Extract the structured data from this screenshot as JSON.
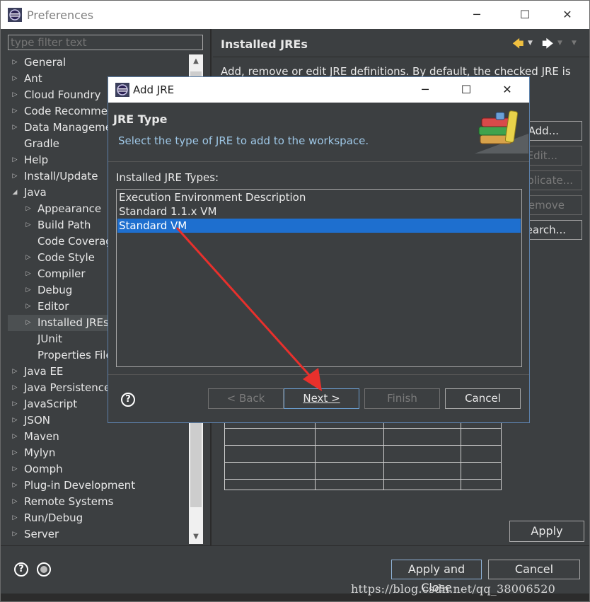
{
  "window": {
    "title": "Preferences",
    "minimize": "─",
    "maximize": "☐",
    "close": "✕"
  },
  "filter": {
    "placeholder": "type filter text"
  },
  "tree": [
    {
      "label": "General",
      "level": 0,
      "arrow": "▷"
    },
    {
      "label": "Ant",
      "level": 0,
      "arrow": "▷"
    },
    {
      "label": "Cloud Foundry",
      "level": 0,
      "arrow": "▷"
    },
    {
      "label": "Code Recomme",
      "level": 0,
      "arrow": "▷"
    },
    {
      "label": "Data Manageme",
      "level": 0,
      "arrow": "▷"
    },
    {
      "label": "Gradle",
      "level": 0,
      "arrow": ""
    },
    {
      "label": "Help",
      "level": 0,
      "arrow": "▷"
    },
    {
      "label": "Install/Update",
      "level": 0,
      "arrow": "▷"
    },
    {
      "label": "Java",
      "level": 0,
      "arrow": "◢"
    },
    {
      "label": "Appearance",
      "level": 1,
      "arrow": "▷"
    },
    {
      "label": "Build Path",
      "level": 1,
      "arrow": "▷"
    },
    {
      "label": "Code Coverag",
      "level": 1,
      "arrow": ""
    },
    {
      "label": "Code Style",
      "level": 1,
      "arrow": "▷"
    },
    {
      "label": "Compiler",
      "level": 1,
      "arrow": "▷"
    },
    {
      "label": "Debug",
      "level": 1,
      "arrow": "▷"
    },
    {
      "label": "Editor",
      "level": 1,
      "arrow": "▷"
    },
    {
      "label": "Installed JREs",
      "level": 1,
      "arrow": "▷",
      "selected": true
    },
    {
      "label": "JUnit",
      "level": 1,
      "arrow": ""
    },
    {
      "label": "Properties File",
      "level": 1,
      "arrow": ""
    },
    {
      "label": "Java EE",
      "level": 0,
      "arrow": "▷"
    },
    {
      "label": "Java Persistence",
      "level": 0,
      "arrow": "▷"
    },
    {
      "label": "JavaScript",
      "level": 0,
      "arrow": "▷"
    },
    {
      "label": "JSON",
      "level": 0,
      "arrow": "▷"
    },
    {
      "label": "Maven",
      "level": 0,
      "arrow": "▷"
    },
    {
      "label": "Mylyn",
      "level": 0,
      "arrow": "▷"
    },
    {
      "label": "Oomph",
      "level": 0,
      "arrow": "▷"
    },
    {
      "label": "Plug-in Development",
      "level": 0,
      "arrow": "▷"
    },
    {
      "label": "Remote Systems",
      "level": 0,
      "arrow": "▷"
    },
    {
      "label": "Run/Debug",
      "level": 0,
      "arrow": "▷"
    },
    {
      "label": "Server",
      "level": 0,
      "arrow": "▷"
    }
  ],
  "right": {
    "title": "Installed JREs",
    "description": "Add, remove or edit JRE definitions. By default, the checked JRE is",
    "buttons": {
      "add": "Add...",
      "edit": "Edit...",
      "duplicate": "plicate...",
      "remove": "emove",
      "search": "earch..."
    },
    "apply": "Apply"
  },
  "footer": {
    "help": "?",
    "apply_close": "Apply and Close",
    "cancel": "Cancel"
  },
  "watermark": "https://blog.csdn.net/qq_38006520",
  "dialog": {
    "title": "Add JRE",
    "minimize": "─",
    "maximize": "☐",
    "close": "✕",
    "heading": "JRE Type",
    "subtitle": "Select the type of JRE to add to the workspace.",
    "list_label": "Installed JRE Types:",
    "types": [
      "Execution Environment Description",
      "Standard 1.1.x VM",
      "Standard VM"
    ],
    "selected_index": 2,
    "help": "?",
    "buttons": {
      "back": "< Back",
      "next": "Next >",
      "finish": "Finish",
      "cancel": "Cancel"
    }
  },
  "colors": {
    "background": "#3c3f41",
    "selection": "#1e6fcf",
    "annotation_arrow": "#e8302c"
  }
}
